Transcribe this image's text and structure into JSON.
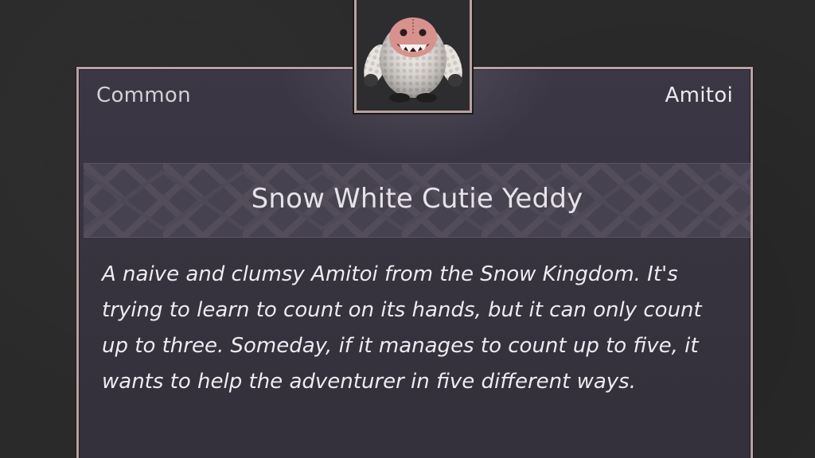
{
  "item": {
    "rarity": "Common",
    "category": "Amitoi",
    "name": "Snow White Cutie Yeddy",
    "description": "A naive and clumsy Amitoi from the Snow Kingdom. It's trying to learn to count on its hands, but it can only count up to three. Someday, if it manages to count up to five, it wants to help the adventurer in five different ways.",
    "portrait_icon": "yeti-amitoi-portrait"
  },
  "colors": {
    "frame_border": "#b8a29f",
    "card_background": "#37333f",
    "title_band": "#47424f",
    "page_background": "#2a2a2a"
  }
}
